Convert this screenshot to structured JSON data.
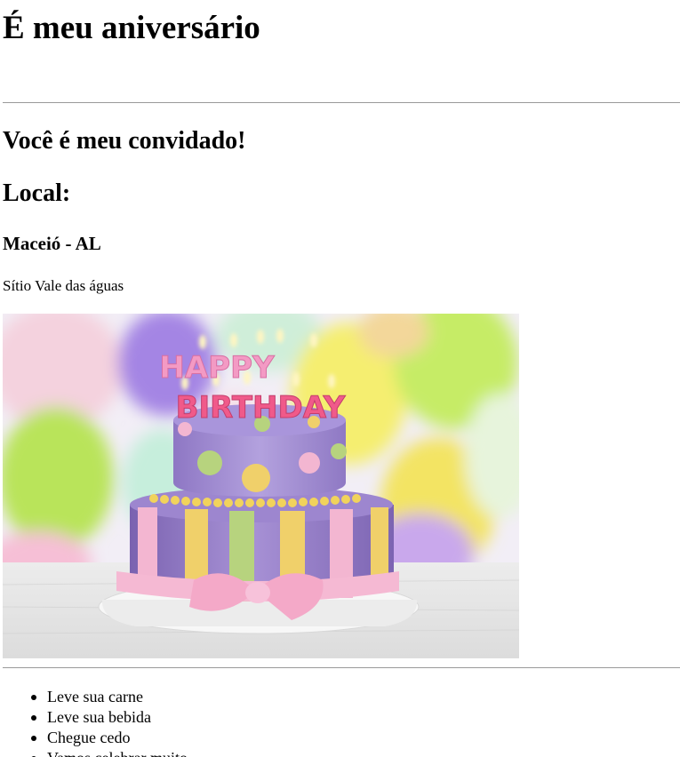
{
  "page": {
    "title": "É meu aniversário",
    "invite_heading": "Você é meu convidado!",
    "location_heading": "Local:",
    "city": "Maceió - AL",
    "venue": "Sítio Vale das águas"
  },
  "photo": {
    "description": "birthday cake with candles and balloons",
    "candles_text_top": "HAPPY",
    "candles_text_bottom": "BIRTHDAY",
    "colors": {
      "cake_purple": "#9a84c8",
      "ribbon_pink": "#f3b3cf",
      "stripe_yellow": "#f0d06a",
      "stripe_green": "#b8d27c",
      "balloon_green": "#c7ec6a",
      "balloon_purple": "#a48ae2",
      "balloon_yellow": "#f6ef6c"
    }
  },
  "list": {
    "items": [
      "Leve sua carne",
      "Leve sua bebida",
      "Chegue cedo",
      "Vamos celebrar muito"
    ]
  }
}
